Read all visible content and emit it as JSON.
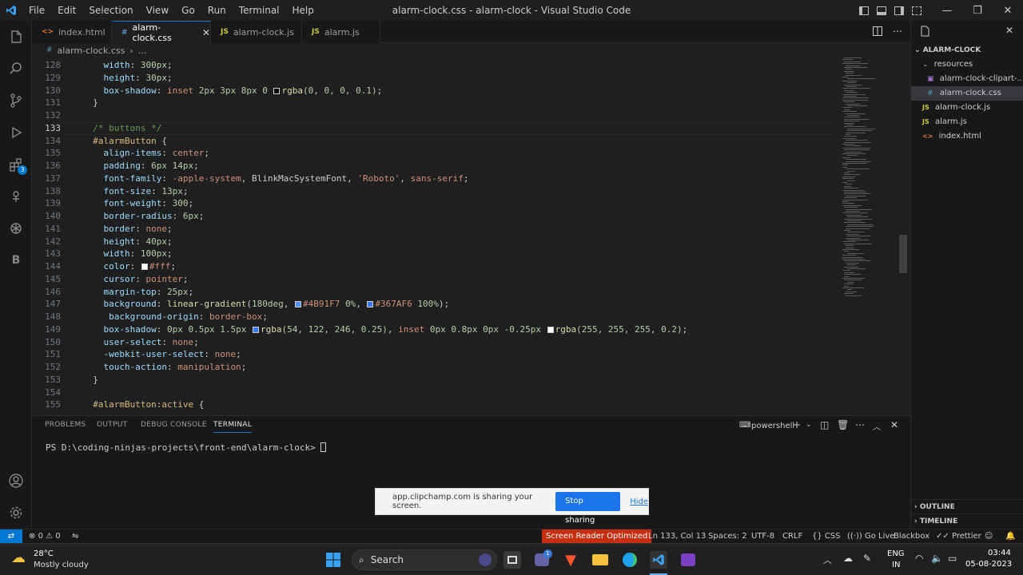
{
  "titlebar": {
    "menu": [
      "File",
      "Edit",
      "Selection",
      "View",
      "Go",
      "Run",
      "Terminal",
      "Help"
    ],
    "title": "alarm-clock.css - alarm-clock - Visual Studio Code"
  },
  "tabs": [
    {
      "label": "index.html",
      "icon": "html-file-icon",
      "badge": "<>",
      "active": false
    },
    {
      "label": "alarm-clock.css",
      "icon": "css-file-icon",
      "badge": "#",
      "active": true
    },
    {
      "label": "alarm-clock.js",
      "icon": "js-file-icon",
      "badge": "JS",
      "active": false
    },
    {
      "label": "alarm.js",
      "icon": "js-file-icon",
      "badge": "JS",
      "active": false
    }
  ],
  "breadcrumb": {
    "file": "alarm-clock.css",
    "sep": "›",
    "rest": "..."
  },
  "activity": {
    "source_control_badge": "3"
  },
  "editor": {
    "current_line": "133",
    "lines": [
      {
        "n": "128",
        "t": [
          [
            "    ",
            ""
          ],
          [
            "width",
            "c-prop"
          ],
          [
            ": ",
            "c-pun"
          ],
          [
            "300px",
            "c-num"
          ],
          [
            ";",
            "c-pun"
          ]
        ]
      },
      {
        "n": "129",
        "t": [
          [
            "    ",
            ""
          ],
          [
            "height",
            "c-prop"
          ],
          [
            ": ",
            "c-pun"
          ],
          [
            "30px",
            "c-num"
          ],
          [
            ";",
            "c-pun"
          ]
        ]
      },
      {
        "n": "130",
        "t": [
          [
            "    ",
            ""
          ],
          [
            "box-shadow",
            "c-prop"
          ],
          [
            ": ",
            "c-pun"
          ],
          [
            "inset ",
            "c-val"
          ],
          [
            "2px 3px 8px 0 ",
            "c-num"
          ],
          [
            "SW:#000000",
            ""
          ],
          [
            "rgba",
            "c-fn"
          ],
          [
            "(0, 0, 0, 0.1)",
            "c-num"
          ],
          [
            ";",
            "c-pun"
          ]
        ]
      },
      {
        "n": "131",
        "t": [
          [
            "  }",
            "c-pun"
          ]
        ]
      },
      {
        "n": "132",
        "t": []
      },
      {
        "n": "133",
        "t": [
          [
            "  ",
            ""
          ],
          [
            "/* buttons */",
            "c-com"
          ]
        ]
      },
      {
        "n": "134",
        "t": [
          [
            "  ",
            ""
          ],
          [
            "#alarmButton",
            "c-sel"
          ],
          [
            " {",
            "c-pun"
          ]
        ]
      },
      {
        "n": "135",
        "t": [
          [
            "    ",
            ""
          ],
          [
            "align-items",
            "c-prop"
          ],
          [
            ": ",
            "c-pun"
          ],
          [
            "center",
            "c-val"
          ],
          [
            ";",
            "c-pun"
          ]
        ]
      },
      {
        "n": "136",
        "t": [
          [
            "    ",
            ""
          ],
          [
            "padding",
            "c-prop"
          ],
          [
            ": ",
            "c-pun"
          ],
          [
            "6px 14px",
            "c-num"
          ],
          [
            ";",
            "c-pun"
          ]
        ]
      },
      {
        "n": "137",
        "t": [
          [
            "    ",
            ""
          ],
          [
            "font-family",
            "c-prop"
          ],
          [
            ": ",
            "c-pun"
          ],
          [
            "-apple-system",
            "c-val"
          ],
          [
            ", BlinkMacSystemFont, ",
            "c-pun"
          ],
          [
            "'Roboto'",
            "c-val"
          ],
          [
            ", ",
            "c-pun"
          ],
          [
            "sans-serif",
            "c-val"
          ],
          [
            ";",
            "c-pun"
          ]
        ]
      },
      {
        "n": "138",
        "t": [
          [
            "    ",
            ""
          ],
          [
            "font-size",
            "c-prop"
          ],
          [
            ": ",
            "c-pun"
          ],
          [
            "13px",
            "c-num"
          ],
          [
            ";",
            "c-pun"
          ]
        ]
      },
      {
        "n": "139",
        "t": [
          [
            "    ",
            ""
          ],
          [
            "font-weight",
            "c-prop"
          ],
          [
            ": ",
            "c-pun"
          ],
          [
            "300",
            "c-num"
          ],
          [
            ";",
            "c-pun"
          ]
        ]
      },
      {
        "n": "140",
        "t": [
          [
            "    ",
            ""
          ],
          [
            "border-radius",
            "c-prop"
          ],
          [
            ": ",
            "c-pun"
          ],
          [
            "6px",
            "c-num"
          ],
          [
            ";",
            "c-pun"
          ]
        ]
      },
      {
        "n": "141",
        "t": [
          [
            "    ",
            ""
          ],
          [
            "border",
            "c-prop"
          ],
          [
            ": ",
            "c-pun"
          ],
          [
            "none",
            "c-val"
          ],
          [
            ";",
            "c-pun"
          ]
        ]
      },
      {
        "n": "142",
        "t": [
          [
            "    ",
            ""
          ],
          [
            "height",
            "c-prop"
          ],
          [
            ": ",
            "c-pun"
          ],
          [
            "40px",
            "c-num"
          ],
          [
            ";",
            "c-pun"
          ]
        ]
      },
      {
        "n": "143",
        "t": [
          [
            "    ",
            ""
          ],
          [
            "width",
            "c-prop"
          ],
          [
            ": ",
            "c-pun"
          ],
          [
            "100px",
            "c-num"
          ],
          [
            ";",
            "c-pun"
          ]
        ]
      },
      {
        "n": "144",
        "t": [
          [
            "    ",
            ""
          ],
          [
            "color",
            "c-prop"
          ],
          [
            ": ",
            "c-pun"
          ],
          [
            "SW:#ffffff",
            ""
          ],
          [
            "#fff",
            "c-val"
          ],
          [
            ";",
            "c-pun"
          ]
        ]
      },
      {
        "n": "145",
        "t": [
          [
            "    ",
            ""
          ],
          [
            "cursor",
            "c-prop"
          ],
          [
            ": ",
            "c-pun"
          ],
          [
            "pointer",
            "c-val"
          ],
          [
            ";",
            "c-pun"
          ]
        ]
      },
      {
        "n": "146",
        "t": [
          [
            "    ",
            ""
          ],
          [
            "margin-top",
            "c-prop"
          ],
          [
            ": ",
            "c-pun"
          ],
          [
            "25px",
            "c-num"
          ],
          [
            ";",
            "c-pun"
          ]
        ]
      },
      {
        "n": "147",
        "t": [
          [
            "    ",
            ""
          ],
          [
            "background",
            "c-prop"
          ],
          [
            ": ",
            "c-pun"
          ],
          [
            "linear-gradient",
            "c-fn"
          ],
          [
            "(",
            "c-pun"
          ],
          [
            "180deg",
            "c-num"
          ],
          [
            ", ",
            "c-pun"
          ],
          [
            "SW:#4B91F7",
            ""
          ],
          [
            "#4B91F7 ",
            "c-val"
          ],
          [
            "0%",
            "c-num"
          ],
          [
            ", ",
            "c-pun"
          ],
          [
            "SW:#367AF6",
            ""
          ],
          [
            "#367AF6 ",
            "c-val"
          ],
          [
            "100%",
            "c-num"
          ],
          [
            ");",
            "c-pun"
          ]
        ]
      },
      {
        "n": "148",
        "t": [
          [
            "     ",
            ""
          ],
          [
            "background-origin",
            "c-prop"
          ],
          [
            ": ",
            "c-pun"
          ],
          [
            "border-box",
            "c-val"
          ],
          [
            ";",
            "c-pun"
          ]
        ]
      },
      {
        "n": "149",
        "t": [
          [
            "    ",
            ""
          ],
          [
            "box-shadow",
            "c-prop"
          ],
          [
            ": ",
            "c-pun"
          ],
          [
            "0px 0.5px 1.5px ",
            "c-num"
          ],
          [
            "SW:#367AF6",
            ""
          ],
          [
            "rgba",
            "c-fn"
          ],
          [
            "(54, 122, 246, 0.25), ",
            "c-num"
          ],
          [
            "inset ",
            "c-val"
          ],
          [
            "0px 0.8px 0px -0.25px ",
            "c-num"
          ],
          [
            "SW:#ffffff",
            ""
          ],
          [
            "rgba",
            "c-fn"
          ],
          [
            "(255, 255, 255, 0.2)",
            "c-num"
          ],
          [
            ";",
            "c-pun"
          ]
        ]
      },
      {
        "n": "150",
        "t": [
          [
            "    ",
            ""
          ],
          [
            "user-select",
            "c-prop"
          ],
          [
            ": ",
            "c-pun"
          ],
          [
            "none",
            "c-val"
          ],
          [
            ";",
            "c-pun"
          ]
        ]
      },
      {
        "n": "151",
        "t": [
          [
            "    ",
            ""
          ],
          [
            "-webkit-user-select",
            "c-prop"
          ],
          [
            ": ",
            "c-pun"
          ],
          [
            "none",
            "c-val"
          ],
          [
            ";",
            "c-pun"
          ]
        ]
      },
      {
        "n": "152",
        "t": [
          [
            "    ",
            ""
          ],
          [
            "touch-action",
            "c-prop"
          ],
          [
            ": ",
            "c-pun"
          ],
          [
            "manipulation",
            "c-val"
          ],
          [
            ";",
            "c-pun"
          ]
        ]
      },
      {
        "n": "153",
        "t": [
          [
            "  }",
            "c-pun"
          ]
        ]
      },
      {
        "n": "154",
        "t": []
      },
      {
        "n": "155",
        "t": [
          [
            "  ",
            ""
          ],
          [
            "#alarmButton:active",
            "c-sel"
          ],
          [
            " {",
            "c-pun"
          ]
        ]
      }
    ]
  },
  "panel": {
    "tabs": [
      "PROBLEMS",
      "OUTPUT",
      "DEBUG CONSOLE",
      "TERMINAL"
    ],
    "active_tab": "TERMINAL",
    "shell": "powershell",
    "prompt": "PS D:\\coding-ninjas-projects\\front-end\\alarm-clock> "
  },
  "share_bar": {
    "message": "app.clipchamp.com is sharing your screen.",
    "stop_label": "Stop sharing",
    "hide_label": "Hide"
  },
  "explorer": {
    "root": "ALARM-CLOCK",
    "folder": "resources",
    "items": [
      {
        "label": "alarm-clock-clipart-...",
        "badge": "▣",
        "indent": "child"
      },
      {
        "label": "alarm-clock.css",
        "badge": "#",
        "selected": true
      },
      {
        "label": "alarm-clock.js",
        "badge": "JS"
      },
      {
        "label": "alarm.js",
        "badge": "JS"
      },
      {
        "label": "index.html",
        "badge": "<>"
      }
    ],
    "outline": "OUTLINE",
    "timeline": "TIMELINE"
  },
  "statusbar": {
    "errors": "0",
    "warnings": "0",
    "screen_reader": "Screen Reader Optimized",
    "position": "Ln 133, Col 13",
    "spaces": "Spaces: 2",
    "encoding": "UTF-8",
    "eol": "CRLF",
    "language": "CSS",
    "golive": "Go Live",
    "blackbox": "Blackbox",
    "prettier": "Prettier"
  },
  "taskbar": {
    "weather_temp": "28°C",
    "weather_desc": "Mostly cloudy",
    "search_label": "Search",
    "lang_top": "ENG",
    "lang_bottom": "IN",
    "time": "03:44",
    "date": "05-08-2023",
    "teams_badge": "1"
  },
  "colors": {
    "accent": "#0078d4",
    "screen_reader_bg": "#c72e0f"
  }
}
